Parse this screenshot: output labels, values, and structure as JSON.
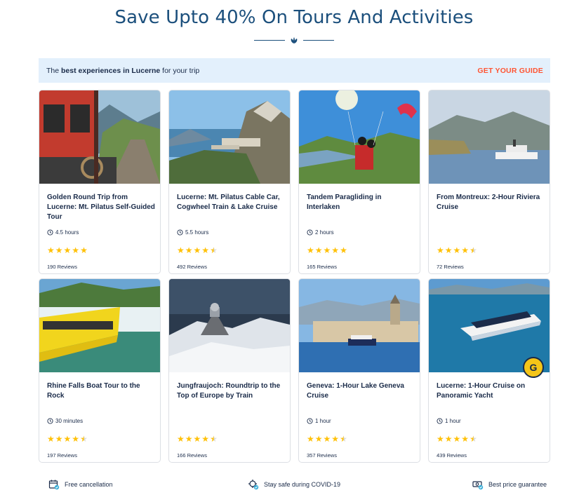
{
  "header": {
    "title": "Save Upto 40% On Tours And Activities"
  },
  "banner": {
    "prefix": "The",
    "highlight": "best experiences in Lucerne",
    "suffix": "for your trip",
    "cta": "GET YOUR GUIDE"
  },
  "colors": {
    "title": "#1b4f7c",
    "banner_bg": "#e3f0fc",
    "cta": "#ff5533",
    "star": "#ffc107",
    "text": "#1a2b49"
  },
  "tours": [
    {
      "title": "Golden Round Trip from Lucerne: Mt. Pilatus Self-Guided Tour",
      "duration": "4.5 hours",
      "rating": 5,
      "reviews": "190 Reviews",
      "image": "cogwheel-train-photo"
    },
    {
      "title": "Lucerne: Mt. Pilatus Cable Car, Cogwheel Train & Lake Cruise",
      "duration": "5.5 hours",
      "rating": 4.5,
      "reviews": "492 Reviews",
      "image": "mountain-summit-photo"
    },
    {
      "title": "Tandem Paragliding in Interlaken",
      "duration": "2 hours",
      "rating": 5,
      "reviews": "165 Reviews",
      "image": "paragliding-photo"
    },
    {
      "title": "From Montreux: 2-Hour Riviera Cruise",
      "duration": "",
      "rating": 4.5,
      "reviews": "72 Reviews",
      "image": "lake-steamer-photo"
    },
    {
      "title": "Rhine Falls Boat Tour to the Rock",
      "duration": "30 minutes",
      "rating": 4.5,
      "reviews": "197 Reviews",
      "image": "rhine-falls-boat-photo"
    },
    {
      "title": "Jungfraujoch: Roundtrip to the Top of Europe by Train",
      "duration": "",
      "rating": 4.5,
      "reviews": "166 Reviews",
      "image": "sphinx-observatory-photo"
    },
    {
      "title": "Geneva: 1-Hour Lake Geneva Cruise",
      "duration": "1 hour",
      "rating": 4.5,
      "reviews": "357 Reviews",
      "image": "geneva-waterfront-photo"
    },
    {
      "title": "Lucerne: 1-Hour Cruise on Panoramic Yacht",
      "duration": "1 hour",
      "rating": 4.5,
      "reviews": "439 Reviews",
      "image": "panoramic-yacht-photo",
      "badge": "G"
    }
  ],
  "footer": {
    "items": [
      {
        "label": "Free cancellation",
        "icon": "calendar-check-icon"
      },
      {
        "label": "Stay safe during COVID-19",
        "icon": "virus-shield-icon"
      },
      {
        "label": "Best price guarantee",
        "icon": "money-check-icon"
      }
    ]
  }
}
